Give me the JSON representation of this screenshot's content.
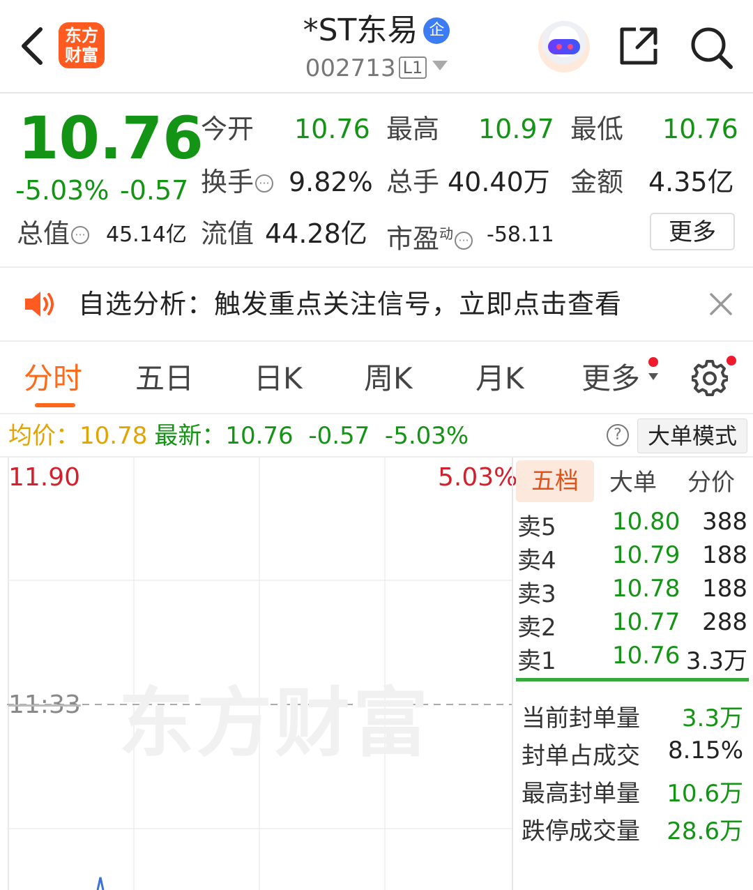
{
  "header": {
    "logo_line1": "东方",
    "logo_line2": "财富",
    "stock_name": "*ST东易",
    "badge": "企",
    "stock_code": "002713",
    "level": "L1"
  },
  "quote": {
    "price": "10.76",
    "change_pct": "-5.03%",
    "change": "-0.57",
    "open_label": "今开",
    "open": "10.76",
    "high_label": "最高",
    "high": "10.97",
    "low_label": "最低",
    "low": "10.76",
    "turnover_label": "换手",
    "turnover": "9.82%",
    "volume_label": "总手",
    "volume": "40.40万",
    "amount_label": "金额",
    "amount": "4.35亿",
    "total_cap_label": "总值",
    "total_cap": "45.14亿",
    "float_cap_label": "流值",
    "float_cap": "44.28亿",
    "pe_label": "市盈",
    "pe_sup": "动",
    "pe": "-58.11",
    "more_label": "更多"
  },
  "notice": {
    "text": "自选分析：触发重点关注信号，立即点击查看"
  },
  "tabs": {
    "items": [
      "分时",
      "五日",
      "日K",
      "周K",
      "月K",
      "更多"
    ],
    "active": "分时"
  },
  "avg_row": {
    "avg_label": "均价：",
    "avg": "10.78",
    "latest_label": "最新：",
    "latest": "10.76",
    "change": "-0.57",
    "change_pct": "-5.03%",
    "help": "?",
    "mode_button": "大单模式"
  },
  "chart": {
    "price_top": "11.90",
    "pct_top": "5.03%",
    "time_label": "11:33",
    "watermark": "东方财富"
  },
  "order_book": {
    "tabs": [
      "五档",
      "大单",
      "分价"
    ],
    "asks": [
      {
        "label": "卖5",
        "price": "10.80",
        "vol": "388"
      },
      {
        "label": "卖4",
        "price": "10.79",
        "vol": "188"
      },
      {
        "label": "卖3",
        "price": "10.78",
        "vol": "188"
      },
      {
        "label": "卖2",
        "price": "10.77",
        "vol": "288"
      },
      {
        "label": "卖1",
        "price": "10.76",
        "vol": "3.3万"
      }
    ],
    "stats": [
      {
        "label": "当前封单量",
        "value": "3.3万"
      },
      {
        "label": "封单占成交",
        "value": "8.15%"
      },
      {
        "label": "最高封单量",
        "value": "10.6万"
      },
      {
        "label": "跌停成交量",
        "value": "28.6万"
      }
    ]
  },
  "colors": {
    "down": "#149414",
    "up": "#d4202c",
    "accent": "#ff6a1a",
    "avg": "#e1a400"
  }
}
